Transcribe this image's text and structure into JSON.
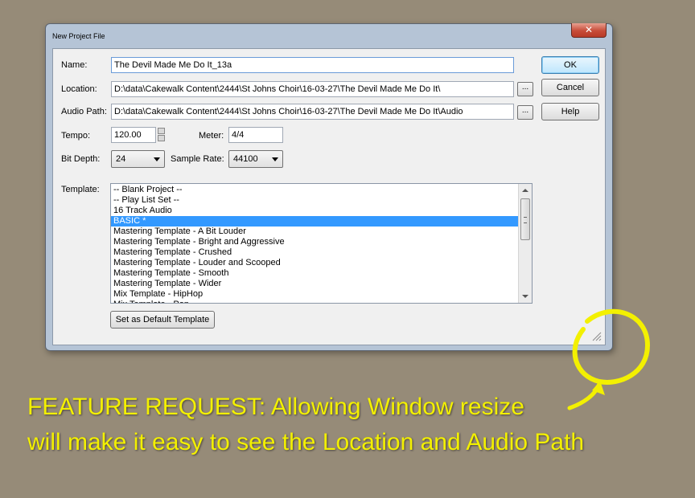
{
  "dialog": {
    "title": "New Project File",
    "close_label": "✕",
    "name_label": "Name:",
    "name_value": "The Devil Made Me Do It_13a",
    "location_label": "Location:",
    "location_value": "D:\\data\\Cakewalk Content\\2444\\St Johns Choir\\16-03-27\\The Devil Made Me Do It\\",
    "audio_path_label": "Audio Path:",
    "audio_path_value": "D:\\data\\Cakewalk Content\\2444\\St Johns Choir\\16-03-27\\The Devil Made Me Do It\\Audio",
    "browse_label": "...",
    "tempo_label": "Tempo:",
    "tempo_value": "120.00",
    "meter_label": "Meter:",
    "meter_value": "4/4",
    "bit_depth_label": "Bit Depth:",
    "bit_depth_value": "24",
    "sample_rate_label": "Sample Rate:",
    "sample_rate_value": "44100",
    "template_label": "Template:",
    "templates": [
      {
        "label": "-- Blank Project --",
        "selected": false
      },
      {
        "label": "-- Play List Set --",
        "selected": false
      },
      {
        "label": "16 Track Audio",
        "selected": false
      },
      {
        "label": "BASIC *",
        "selected": true
      },
      {
        "label": "Mastering Template - A Bit Louder",
        "selected": false
      },
      {
        "label": "Mastering Template - Bright and Aggressive",
        "selected": false
      },
      {
        "label": "Mastering Template - Crushed",
        "selected": false
      },
      {
        "label": "Mastering Template - Louder and Scooped",
        "selected": false
      },
      {
        "label": "Mastering Template - Smooth",
        "selected": false
      },
      {
        "label": "Mastering Template - Wider",
        "selected": false
      },
      {
        "label": "Mix Template - HipHop",
        "selected": false
      },
      {
        "label": "Mix Template - Pop",
        "selected": false
      }
    ],
    "set_default_label": "Set as Default Template",
    "ok_label": "OK",
    "cancel_label": "Cancel",
    "help_label": "Help"
  },
  "caption": {
    "line1": "FEATURE REQUEST:  Allowing Window resize",
    "line2": "will make it easy to see the Location and Audio Path",
    "color": "#f3f000"
  }
}
